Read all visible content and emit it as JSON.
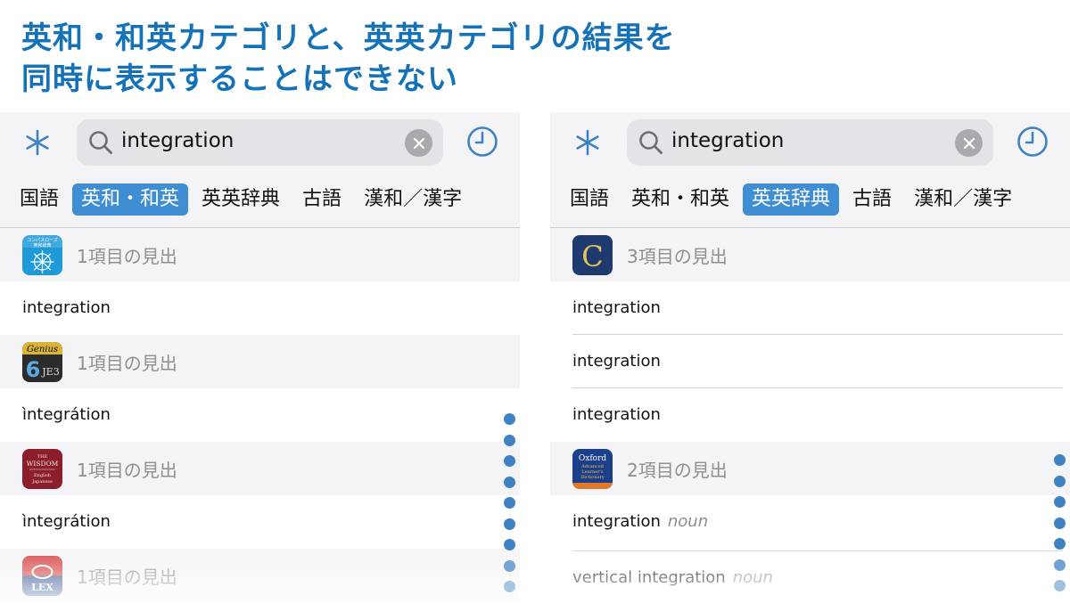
{
  "headline": {
    "line1": "英和・和英カテゴリと、英英カテゴリの結果を",
    "line2": "同時に表示することはできない"
  },
  "colors": {
    "accent": "#1572b6",
    "tab_active": "#3f8ed3",
    "dot": "#3f82c4"
  },
  "left": {
    "search": {
      "query": "integration"
    },
    "tabs": [
      "国語",
      "英和・和英",
      "英英辞典",
      "古語",
      "漢和／漢字"
    ],
    "active_tab": "英和・和英",
    "rows": [
      {
        "type": "header",
        "icon": "compass-dictionary-icon",
        "text": "1項目の見出",
        "icon_text": "コンパスローズ 英和辞典"
      },
      {
        "type": "entry",
        "text": "integration"
      },
      {
        "type": "header",
        "icon": "genius-dictionary-icon",
        "text": "1項目の見出",
        "icon_text": "Genius"
      },
      {
        "type": "entry",
        "text": "ìntegrátion"
      },
      {
        "type": "header",
        "icon": "wisdom-dictionary-icon",
        "text": "1項目の見出",
        "icon_text": "THE WISDOM"
      },
      {
        "type": "entry",
        "text": "ìntegrátion"
      },
      {
        "type": "header",
        "icon": "lex-dictionary-icon",
        "text": "1項目の見出",
        "icon_text": "LEX"
      }
    ]
  },
  "right": {
    "search": {
      "query": "integration"
    },
    "tabs": [
      "国語",
      "英和・和英",
      "英英辞典",
      "古語",
      "漢和／漢字"
    ],
    "active_tab": "英英辞典",
    "rows": [
      {
        "type": "header",
        "icon": "collins-c-icon",
        "text": "3項目の見出",
        "icon_text": "C"
      },
      {
        "type": "entry",
        "text": "integration"
      },
      {
        "type": "entry",
        "text": "integration"
      },
      {
        "type": "entry",
        "text": "integration"
      },
      {
        "type": "header",
        "icon": "oxford-dictionary-icon",
        "text": "2項目の見出",
        "icon_text": "Oxford"
      },
      {
        "type": "entry",
        "text": "integration",
        "pos": "noun"
      },
      {
        "type": "entry",
        "text": "vertical integration",
        "pos": "noun"
      }
    ]
  }
}
